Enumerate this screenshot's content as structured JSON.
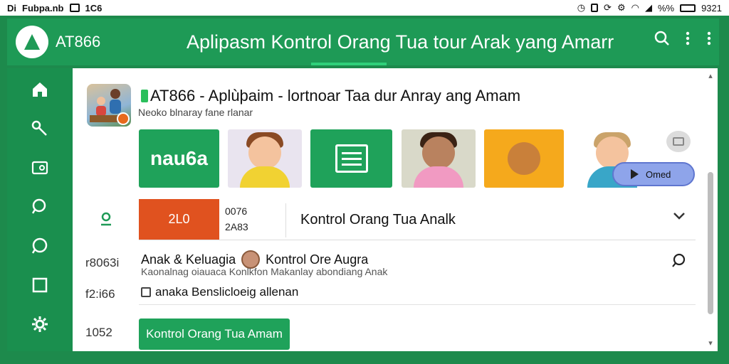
{
  "statusbar": {
    "left_text": "Di",
    "app_label": "Fubpa.nb",
    "mid_label": "1C6",
    "right_text": "%%",
    "time": "9321"
  },
  "appbar": {
    "app_name": "AT866",
    "title": "Aplipasm Kontrol Orang Tua tour Arak yang Amarr",
    "search_icon": "search-icon",
    "more_icon": "more-vert-icon"
  },
  "nav": {
    "items": [
      {
        "icon": "home-icon",
        "glyph": "⌂"
      },
      {
        "icon": "key-icon",
        "glyph": "⚷"
      },
      {
        "icon": "image-icon",
        "glyph": "▣"
      },
      {
        "icon": "search-icon",
        "glyph": "○"
      },
      {
        "icon": "chat-icon",
        "glyph": "◯"
      },
      {
        "icon": "square-icon",
        "glyph": "□"
      },
      {
        "icon": "gear-icon",
        "glyph": "⚙"
      }
    ]
  },
  "hero": {
    "title": "AT866 - Aplùþaim - lortnoar Taa dur Anray ang Amam",
    "subtitle": "Neoko blnaray fane rlanar"
  },
  "tiles": {
    "code_tile": "nau6a",
    "omed_label": "Omed"
  },
  "selector": {
    "badge": "2L0",
    "codes": [
      "0076",
      "2A83"
    ],
    "label": "Kontrol Orang Tua Analk"
  },
  "rows": [
    {
      "number": "r8063i",
      "title_a": "Anak & Keluagia",
      "title_b": "Kontrol Ore Augra",
      "subtitle": "Kaonalnag oiauaca     Konlkfon Makanlay abondiang Anak"
    },
    {
      "number": "f2:i66",
      "label": "anaka Benslicloeig allenan"
    }
  ],
  "footer": {
    "number": "1052",
    "button_label": "Kontrol Orang Tua Amam"
  },
  "colors": {
    "primary": "#1e9a56",
    "accent_orange": "#e0521f",
    "tile_yellow": "#f5a91c",
    "pill_blue": "#8ea4ea"
  }
}
